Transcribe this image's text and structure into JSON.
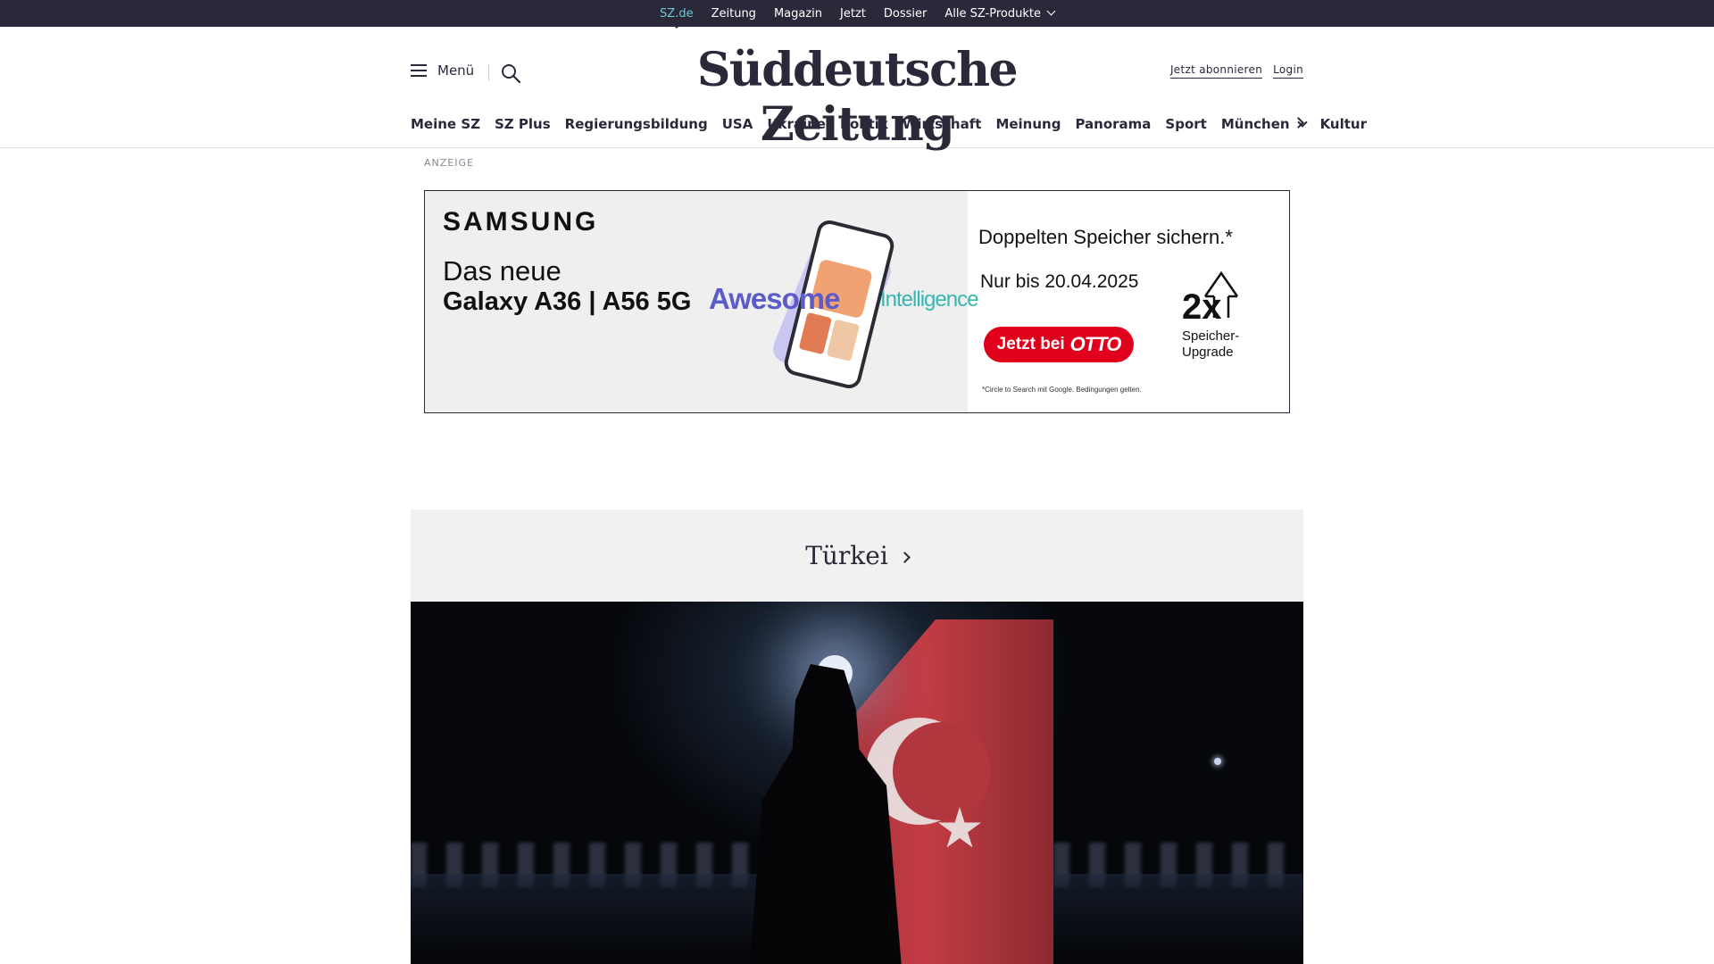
{
  "topbar": {
    "links": [
      "SZ.de",
      "Zeitung",
      "Magazin",
      "Jetzt",
      "Dossier"
    ],
    "products_label": "Alle SZ-Produkte"
  },
  "header": {
    "menu_label": "Menü",
    "logo": "Süddeutsche Zeitung",
    "subscribe_label": "Jetzt abonnieren",
    "login_label": "Login"
  },
  "nav": {
    "items": [
      "Meine SZ",
      "SZ Plus",
      "Regierungsbildung",
      "USA",
      "Ukraine",
      "Politik",
      "Wirtschaft",
      "Meinung",
      "Panorama",
      "Sport",
      "München",
      "Kultur"
    ]
  },
  "ad": {
    "label": "ANZEIGE",
    "brand": "SAMSUNG",
    "headline_1": "Das neue",
    "headline_2": "Galaxy A36 | A56 5G",
    "word_1": "Awesome",
    "word_2": "Intelligence",
    "tagline": "Doppelten Speicher sichern.*",
    "date_text": "Nur bis 20.04.2025",
    "cta_text": "Jetzt bei",
    "cta_brand": "OTTO",
    "badge": "2x",
    "badge_text": "Speicher-Upgrade",
    "fineprint": "*Circle to Search mit Google. Bedingungen gelten."
  },
  "section": {
    "title": "Türkei"
  },
  "colors": {
    "topbar_bg": "#29293a",
    "accent": "#71c6d4",
    "section_bg": "#f1f1f1",
    "otto_red": "#e0001b"
  }
}
